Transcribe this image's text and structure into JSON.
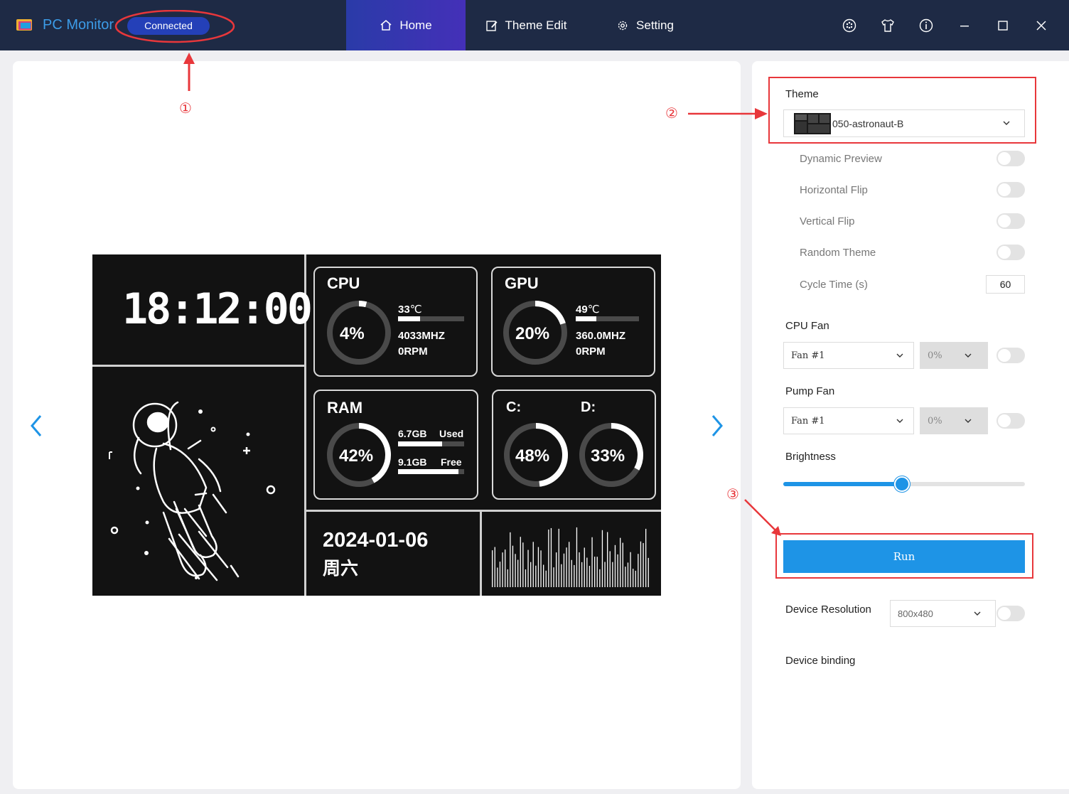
{
  "app": {
    "title": "PC Monitor",
    "status": "Connected"
  },
  "nav": {
    "home": "Home",
    "theme_edit": "Theme Edit",
    "setting": "Setting"
  },
  "window_icons": [
    "palette-icon",
    "shirt-icon",
    "info-icon",
    "minimize-icon",
    "maximize-icon",
    "close-icon"
  ],
  "annotations": {
    "one": "①",
    "two": "②",
    "three": "③"
  },
  "screen": {
    "time": "18:12:00",
    "cpu": {
      "label": "CPU",
      "percent": "4%",
      "temp": "33",
      "temp_unit": "℃",
      "freq": "4033MHZ",
      "rpm": "0RPM",
      "ring_fraction": 0.04
    },
    "gpu": {
      "label": "GPU",
      "percent": "20%",
      "temp": "49",
      "temp_unit": "℃",
      "freq": "360.0MHZ",
      "rpm": "0RPM",
      "ring_fraction": 0.2
    },
    "ram": {
      "label": "RAM",
      "percent": "42%",
      "used_val": "6.7GB",
      "used_lbl": "Used",
      "free_val": "9.1GB",
      "free_lbl": "Free",
      "ring_fraction": 0.42
    },
    "disk": {
      "c_label": "C:",
      "d_label": "D:",
      "c_percent": "48%",
      "d_percent": "33%",
      "c_fraction": 0.48,
      "d_fraction": 0.33
    },
    "date": "2024-01-06",
    "weekday": "周六"
  },
  "side": {
    "theme_label": "Theme",
    "theme_value": "050-astronaut-B",
    "dynamic_preview": "Dynamic Preview",
    "horizontal_flip": "Horizontal Flip",
    "vertical_flip": "Vertical Flip",
    "random_theme": "Random Theme",
    "cycle_time_label": "Cycle Time (s)",
    "cycle_time_value": "60",
    "cpu_fan_label": "CPU Fan",
    "cpu_fan_value": "Fan #1",
    "cpu_fan_speed": "0%",
    "pump_fan_label": "Pump Fan",
    "pump_fan_value": "Fan #1",
    "pump_fan_speed": "0%",
    "brightness_label": "Brightness",
    "brightness_value": 0.49,
    "run_label": "Run",
    "resolution_label": "Device Resolution",
    "resolution_value": "800x480",
    "binding_label": "Device binding"
  },
  "colors": {
    "accent": "#1e94e6",
    "titlebar": "#1e2a45",
    "annotation": "#e8373b",
    "status": "#2440b8"
  }
}
